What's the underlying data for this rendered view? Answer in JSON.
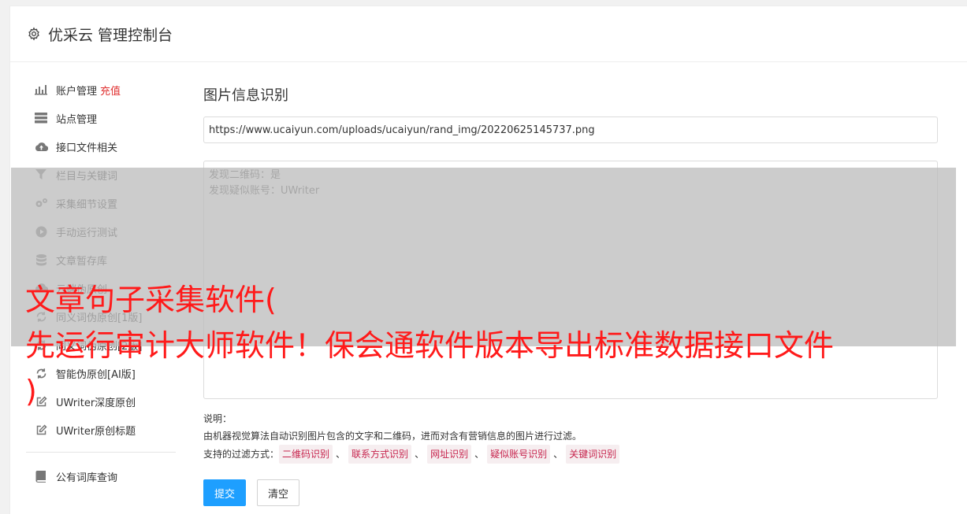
{
  "header": {
    "title": "优采云 管理控制台",
    "icon": "gear-icon"
  },
  "sidebar": {
    "items": [
      {
        "label": "账户管理",
        "extra": "充值",
        "icon": "bar-chart-icon"
      },
      {
        "label": "站点管理",
        "icon": "server-icon"
      },
      {
        "label": "接口文件相关",
        "icon": "cloud-upload-icon"
      },
      {
        "label": "栏目与关键词",
        "icon": "filter-icon"
      },
      {
        "label": "采集细节设置",
        "icon": "gears-icon"
      },
      {
        "label": "手动运行测试",
        "icon": "play-circle-icon"
      },
      {
        "label": "文章暂存库",
        "icon": "database-icon"
      },
      {
        "label": "云端伪原创",
        "icon": "cloud-icon"
      },
      {
        "label": "同义词伪原创[1版]",
        "icon": "refresh-icon"
      },
      {
        "label": "同义词伪原创[2版]",
        "icon": "refresh-icon"
      },
      {
        "label": "智能伪原创[AI版]",
        "icon": "refresh-icon"
      },
      {
        "label": "UWriter深度原创",
        "icon": "edit-icon"
      },
      {
        "label": "UWriter原创标题",
        "icon": "edit-icon"
      }
    ],
    "bottom_items": [
      {
        "label": "公有词库查询",
        "icon": "book-icon"
      }
    ]
  },
  "main": {
    "title": "图片信息识别",
    "url_value": "https://www.ucaiyun.com/uploads/ucaiyun/rand_img/20220625145737.png",
    "result_lines": [
      "发现二维码：是",
      "发现疑似账号：UWriter"
    ],
    "desc_title": "说明：",
    "desc_text": "由机器视觉算法自动识别图片包含的文字和二维码，进而对含有营销信息的图片进行过滤。",
    "filter_label": "支持的过滤方式：",
    "filter_tags": [
      "二维码识别",
      "联系方式识别",
      "网址识别",
      "疑似账号识别",
      "关键词识别"
    ],
    "filter_sep": "、",
    "submit_label": "提交",
    "clear_label": "清空"
  },
  "overlay": {
    "lines": [
      "文章句子采集软件(",
      "先运行审计大师软件！保会通软件版本导出标准数据接口文件",
      ")"
    ]
  },
  "colors": {
    "primary": "#1e9fff",
    "recharge": "#e03030",
    "tag_text": "#c7254e",
    "overlay_text": "#ff1a1a"
  }
}
